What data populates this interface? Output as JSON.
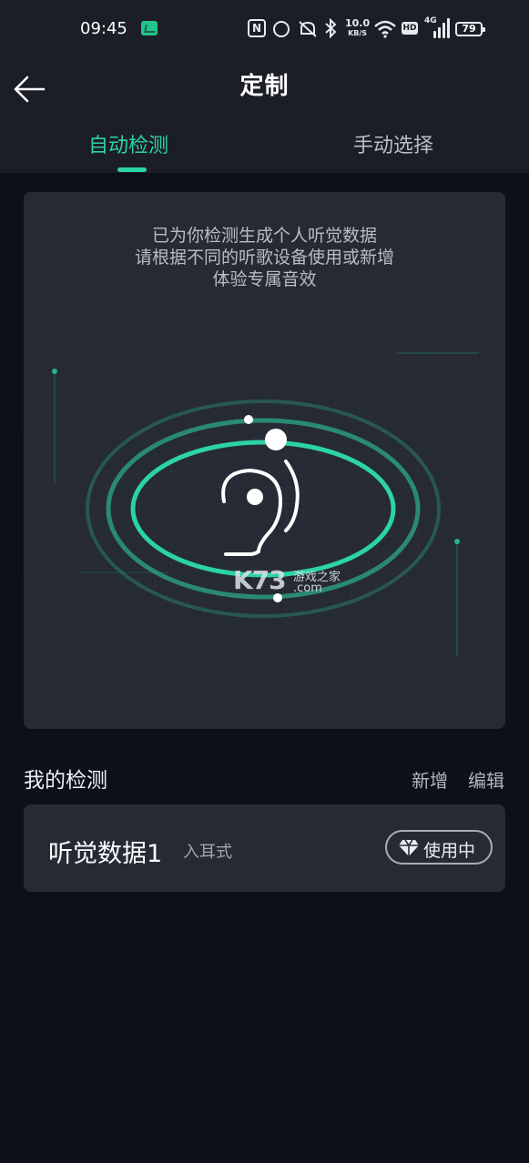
{
  "status_bar": {
    "time": "09:45",
    "nfc_icon": "N",
    "network_speed_value": "10.0",
    "network_speed_unit": "KB/S",
    "hd_label": "HD",
    "signal_label": "4G",
    "battery": "79"
  },
  "header": {
    "title": "定制",
    "back_icon": "arrow-left-icon"
  },
  "tabs": [
    {
      "label": "自动检测",
      "active": true
    },
    {
      "label": "手动选择",
      "active": false
    }
  ],
  "detection_card": {
    "lines": [
      "已为你检测生成个人听觉数据",
      "请根据不同的听歌设备使用或新增",
      "体验专属音效"
    ],
    "icon": "ear-icon"
  },
  "watermark": {
    "brand": "K73",
    "chinese": "游戏之家",
    "domain": ".com"
  },
  "my_detection": {
    "title": "我的检测",
    "add_label": "新增",
    "edit_label": "编辑",
    "items": [
      {
        "name": "听觉数据1",
        "type": "入耳式",
        "status": "使用中",
        "status_icon": "diamond-icon"
      }
    ]
  },
  "colors": {
    "accent": "#2cd3a4",
    "background": "#0d101b",
    "card": "#262a35",
    "header": "#1b1e27"
  }
}
